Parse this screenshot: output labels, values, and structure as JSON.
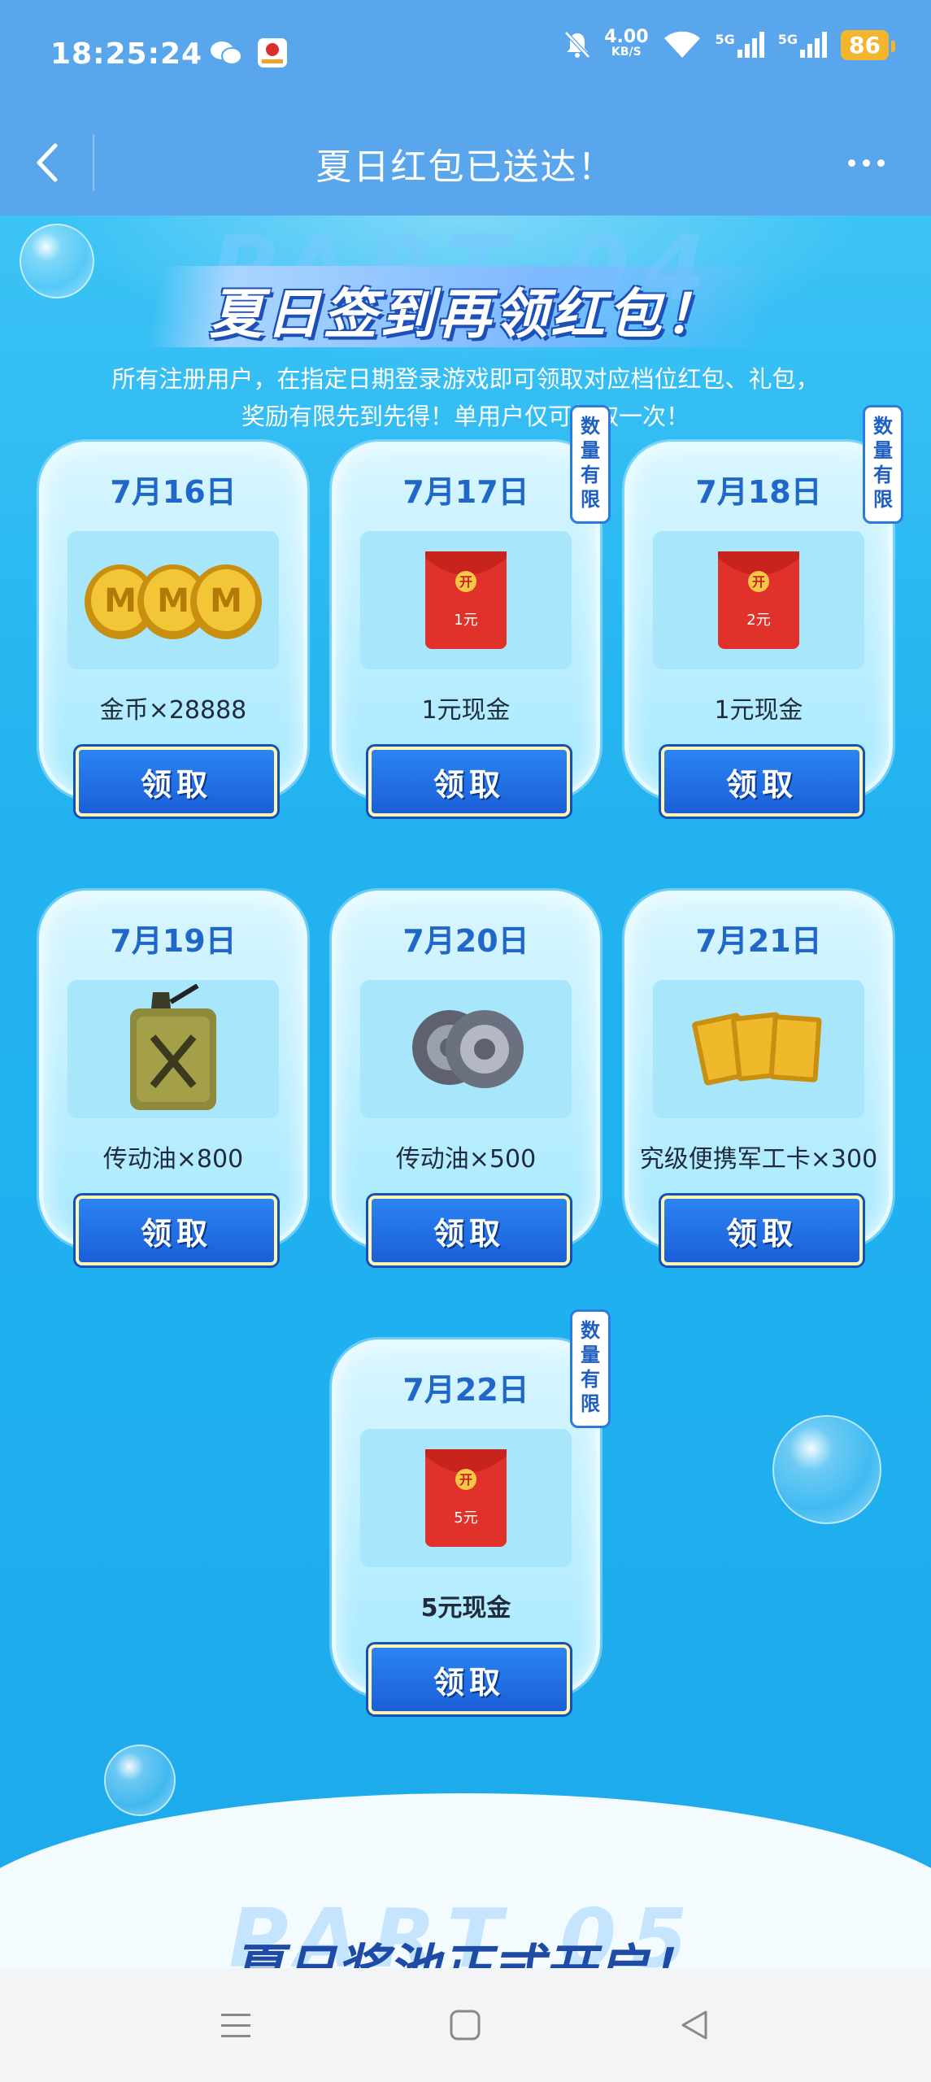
{
  "status_bar": {
    "time": "18:25:24",
    "net_speed_value": "4.00",
    "net_speed_unit": "KB/S",
    "signal1": "5G",
    "signal2": "5G",
    "battery": "86"
  },
  "app_bar": {
    "title": "夏日红包已送达！"
  },
  "section": {
    "ghost_text": "PART 04",
    "title": "夏日签到再领红包！",
    "intro_line1": "所有注册用户，在指定日期登录游戏即可领取对应档位红包、礼包，",
    "intro_line2": "奖励有限先到先得！单用户仅可领取一次！",
    "claim_label": "领取",
    "limit_badge": "数量有限",
    "next_ghost_text": "PART 05",
    "next_title": "夏日奖池正式开启！"
  },
  "rewards": [
    {
      "date": "7月16日",
      "label": "金币×28888",
      "icon": "gold-coins-icon",
      "limited": false
    },
    {
      "date": "7月17日",
      "label": "1元现金",
      "icon": "red-envelope-icon",
      "amount": "1元",
      "limited": true
    },
    {
      "date": "7月18日",
      "label": "1元现金",
      "icon": "red-envelope-icon",
      "amount": "2元",
      "limited": true
    },
    {
      "date": "7月19日",
      "label": "传动油×800",
      "icon": "jerry-can-icon",
      "limited": false
    },
    {
      "date": "7月20日",
      "label": "传动油×500",
      "icon": "gear-parts-icon",
      "limited": false
    },
    {
      "date": "7月21日",
      "label": "究级便携军工卡×300",
      "icon": "military-cards-icon",
      "limited": false
    },
    {
      "date": "7月22日",
      "label": "5元现金",
      "icon": "red-envelope-icon",
      "amount": "5元",
      "limited": true
    }
  ],
  "colors": {
    "app_bar": "#5aa6ec",
    "background": "#2fb6ee",
    "button": "#1a5fd8",
    "date_text": "#1f67c8"
  }
}
